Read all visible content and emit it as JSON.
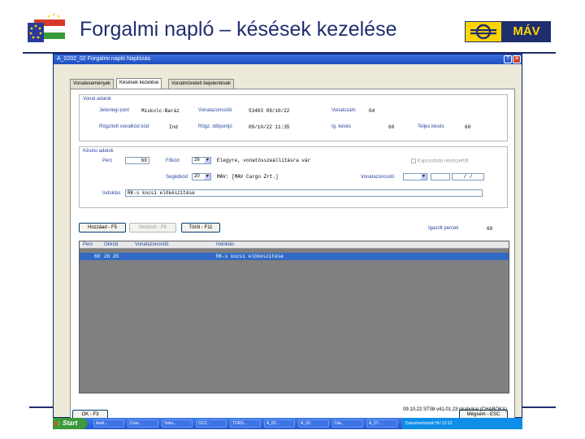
{
  "slide": {
    "title": "Forgalmi napló – késések kezelése",
    "mav_logo_text": "MÁV",
    "brand_color": "#1f2f6e",
    "accent_color": "#ffd400"
  },
  "window": {
    "title": "A_0202_02   Forgalmi napló   Naplózás",
    "help_label": "?",
    "close_label": "✕",
    "tabs": [
      {
        "label": "Vonatesemények"
      },
      {
        "label": "Késések kezelése"
      },
      {
        "label": "Vonatmûveleti bejelentések"
      }
    ],
    "train_data": {
      "group_title": "Vonat adatok",
      "start_label": "Jelenlegi pont",
      "start_value": "Miskolc-Baráz",
      "train_id_label": "Vonatazonosító",
      "train_id_value": "53403 09/10/22",
      "train_no_label": "Vonatszám",
      "train_no_value": "G4",
      "reg_code_label": "Rögzített vonalkód kód",
      "reg_code_value": "Ind",
      "reg_time_label": "Rögz. időpontjó",
      "reg_time_value": "09/10/22 11:35",
      "actual_delay_label": "Ig. késés",
      "actual_delay_value": "60",
      "total_delay_label": "Teljes késés",
      "total_delay_value": "60"
    },
    "delay_data": {
      "group_title": "Késési adatok",
      "minutes_label": "Perc",
      "minutes_value": "60",
      "main_code_label": "Főkód",
      "main_code_value": "26",
      "main_code_desc": "Elegyre, vonatösszeállításra vár",
      "checkbox_label": "Kapcsolódó rendszertől",
      "sub_code_label": "Segédkód",
      "sub_code_value": "20",
      "sub_code_desc": "MÁV: [MÁV Cargo Zrt.]",
      "train_id_label": "Vonatazonosító",
      "date_value": "/ /",
      "reason_label": "Indoklás",
      "reason_value": "RK-s kocsi előkészítése"
    },
    "buttons": {
      "add": "Hozzáad - F5",
      "modify": "Módosít - F6",
      "delete": "Töröl - F11",
      "ok": "OK - F3",
      "cancel": "Mégsem - ESC"
    },
    "accepted_minutes_label": "Igazolt percek",
    "accepted_minutes_value": "60",
    "grid": {
      "columns": [
        "Perc",
        "Okkód",
        "Vonatazonosító",
        "Indoklás"
      ],
      "rows": [
        {
          "perc": "60",
          "okkod": "26  2G",
          "vonat": "",
          "indoklas": "RK-s kocsi előkészítése"
        }
      ]
    },
    "status_text": "09.10.22 ST08 v41.01.23 pkabokai (CHABOKA)"
  },
  "taskbar": {
    "start_label": "Start",
    "tasks": [
      "Andr...",
      "Com...",
      "Yaho...",
      "OCZ...",
      "TORS...",
      "A_02...",
      "A_02...",
      "Uta...",
      "A_07..."
    ],
    "tray_text": "Dokumentumok  HU  12:12"
  }
}
